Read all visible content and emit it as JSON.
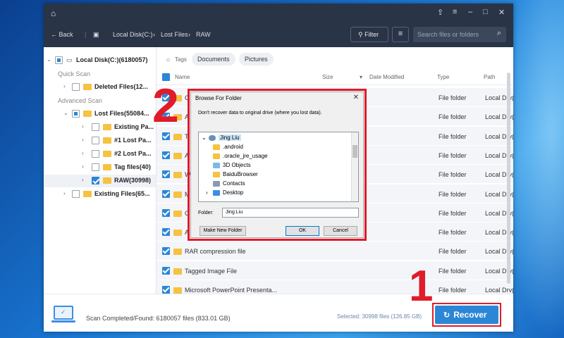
{
  "app": {
    "toolbar": {
      "back_label": "Back",
      "breadcrumb": [
        "Local Disk(C:)",
        "Lost Files",
        "RAW"
      ],
      "filter_label": "Filter",
      "search_placeholder": "Search files or folders"
    },
    "sidebar": {
      "root": "Local Disk(C:)(6180057)",
      "quick_scan_label": "Quick Scan",
      "deleted_files": "Deleted Files(12...",
      "advanced_scan_label": "Advanced Scan",
      "lost_files": "Lost Files(55084...",
      "items": [
        "Existing Pa...",
        "#1 Lost Pa...",
        "#2 Lost Pa...",
        "Tag files(40)",
        "RAW(30998)"
      ],
      "existing_files": "Existing Files(65..."
    },
    "main": {
      "tags_label": "Tags",
      "tags": [
        "Documents",
        "Pictures"
      ],
      "columns": {
        "name": "Name",
        "size": "Size",
        "date": "Date Modified",
        "type": "Type",
        "path": "Path"
      },
      "rows": [
        {
          "name": "C",
          "type": "File folder",
          "path": "Local Drv(C:\\Lost F..."
        },
        {
          "name": "A",
          "type": "File folder",
          "path": "Local Drv(C:\\Lost F..."
        },
        {
          "name": "T",
          "type": "File folder",
          "path": "Local Drv(C:\\Lost F..."
        },
        {
          "name": "A",
          "type": "File folder",
          "path": "Local Drv(C:\\Lost F..."
        },
        {
          "name": "W",
          "type": "File folder",
          "path": "Local Drv(C:\\Lost F..."
        },
        {
          "name": "M",
          "type": "File folder",
          "path": "Local Drv(C:\\Lost F..."
        },
        {
          "name": "C",
          "type": "File folder",
          "path": "Local Drv(C:\\Lost F..."
        },
        {
          "name": "A",
          "type": "File folder",
          "path": "Local Drv(C:\\Lost F..."
        },
        {
          "name": "RAR compression file",
          "type": "File folder",
          "path": "Local Drv(C:\\Lost F..."
        },
        {
          "name": "Tagged Image File",
          "type": "File folder",
          "path": "Local Drv(C:\\Lost F..."
        },
        {
          "name": "Microsoft PowerPoint Presenta...",
          "type": "File folder",
          "path": "Local Drv(C:\\Lost F..."
        }
      ]
    },
    "status": {
      "scan_text": "Scan Completed/Found: 6180057 files (833.01 GB)",
      "selected_text": "Selected: 30998 files (126.85 GB)",
      "recover_label": "Recover"
    }
  },
  "annotations": {
    "step1": "1",
    "step2": "2"
  },
  "dialog": {
    "title": "Browse For Folder",
    "description": "Don't recover data to original drive (where you lost data).",
    "tree": [
      "Jing Liu",
      ".android",
      ".oracle_jre_usage",
      "3D Objects",
      "BaiduBrowser",
      "Contacts",
      "Desktop"
    ],
    "folder_label": "Folder:",
    "folder_value": "Jing Liu",
    "make_new_folder": "Make New Folder",
    "ok": "OK",
    "cancel": "Cancel"
  },
  "colors": {
    "accent": "#2b86d6",
    "highlight": "#e01b2a",
    "titlebar": "#2a3447"
  }
}
